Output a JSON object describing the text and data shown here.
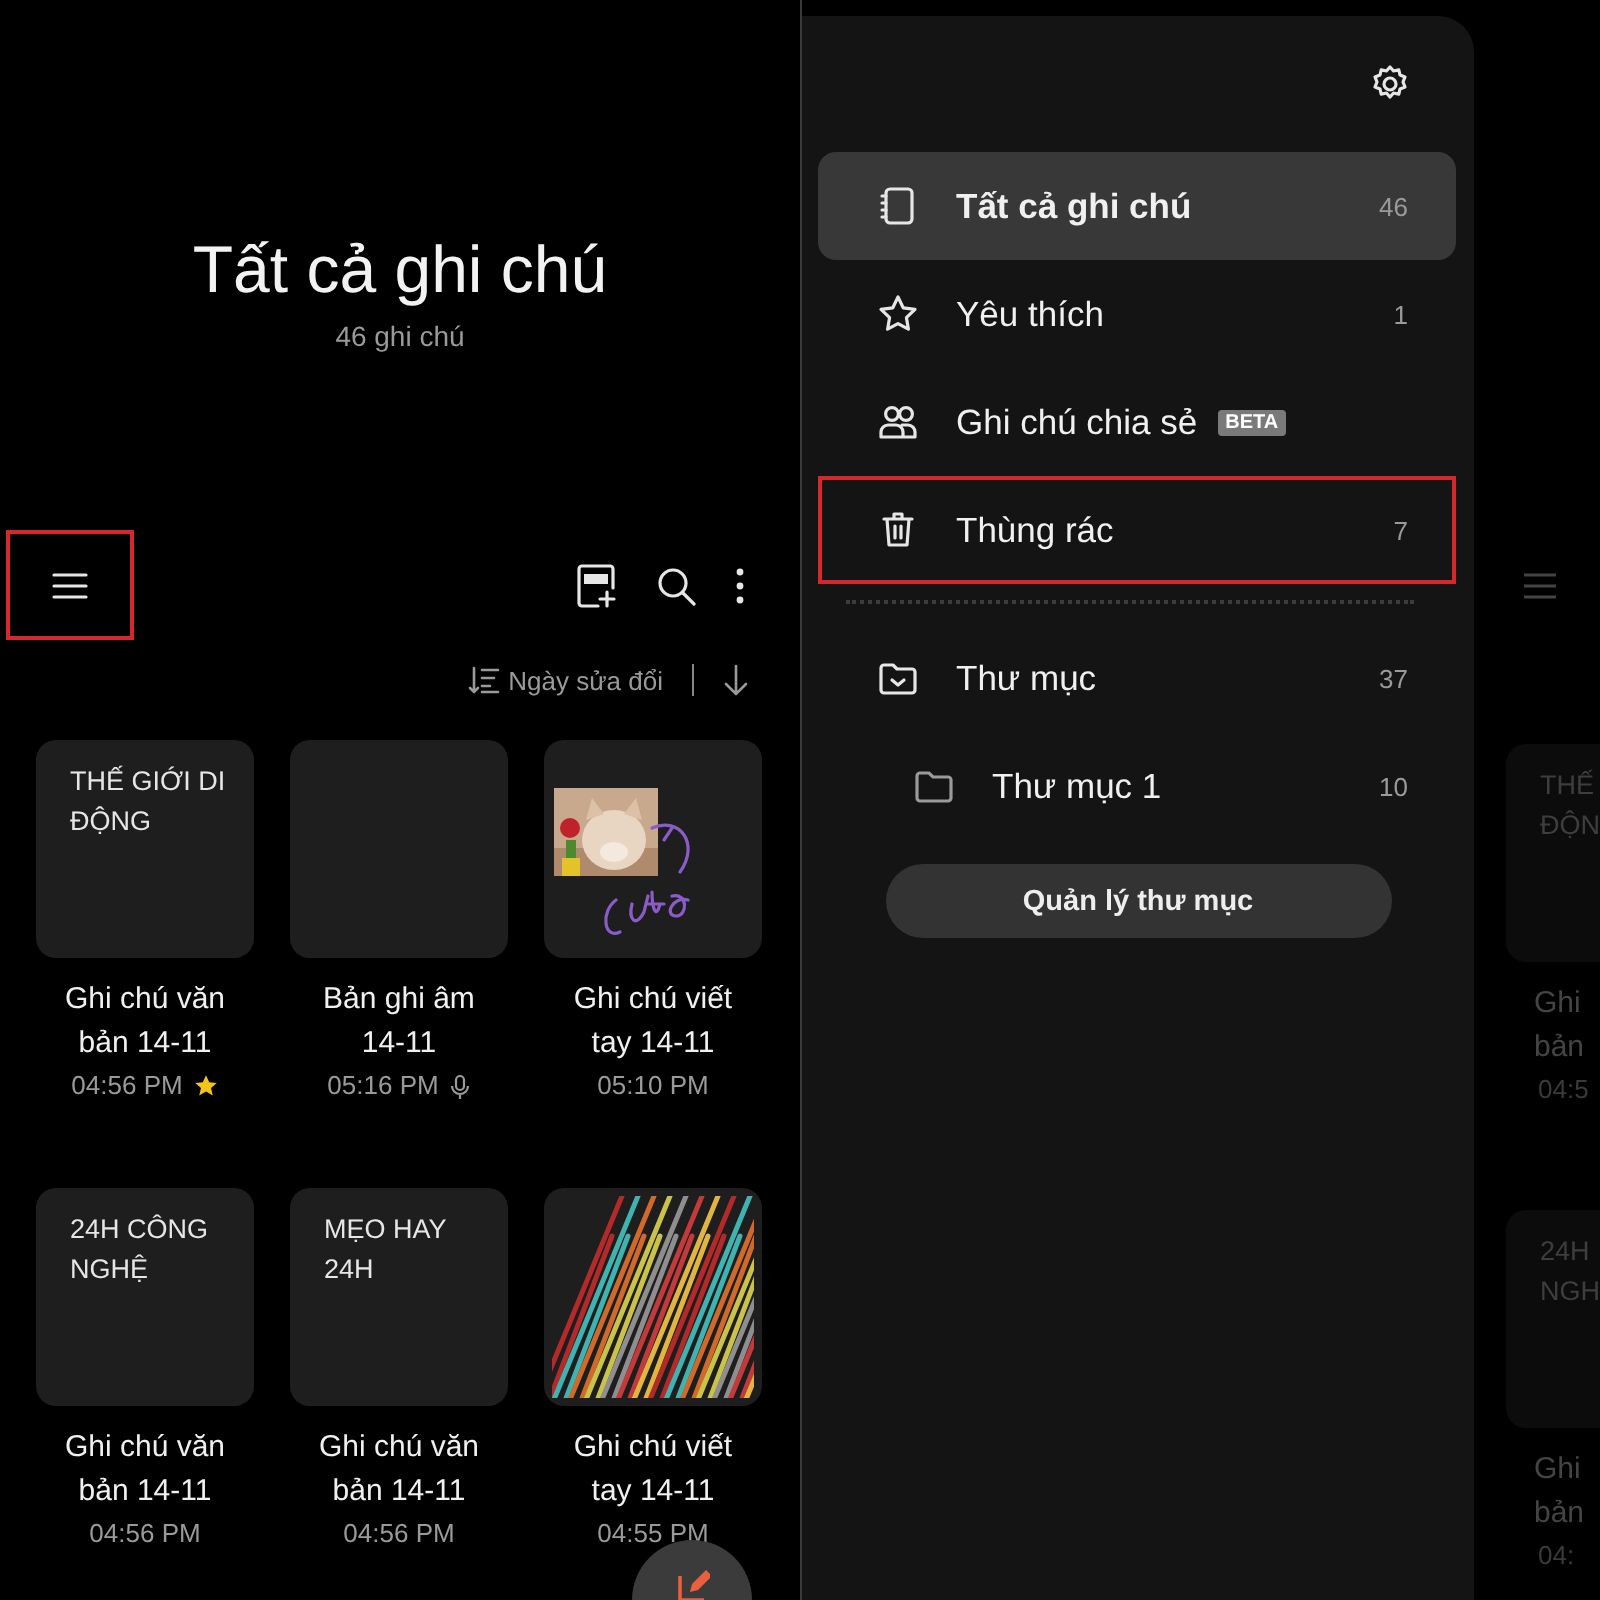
{
  "notes_screen": {
    "title": "Tất cả ghi chú",
    "subtitle": "46 ghi chú",
    "menu_button": {
      "highlighted": true
    },
    "sort": {
      "label": "Ngày sửa đổi"
    },
    "notes": [
      {
        "kind": "text",
        "preview": [
          "THẾ GIỚI DI",
          "ĐỘNG"
        ],
        "title": [
          "Ghi chú văn",
          "bản 14-11"
        ],
        "time": "04:56 PM",
        "favorite": true
      },
      {
        "kind": "audio",
        "title": [
          "Bản ghi âm",
          "14-11"
        ],
        "time": "05:16 PM",
        "favorite": false
      },
      {
        "kind": "handwriting_photo",
        "title": [
          "Ghi chú viết",
          "tay 14-11"
        ],
        "time": "05:10 PM",
        "favorite": false
      },
      {
        "kind": "text",
        "preview": [
          "24H CÔNG",
          "NGHỆ"
        ],
        "title": [
          "Ghi chú văn",
          "bản 14-11"
        ],
        "time": "04:56 PM",
        "favorite": false
      },
      {
        "kind": "text",
        "preview": [
          "MẸO HAY",
          "24H"
        ],
        "title": [
          "Ghi chú văn",
          "bản 14-11"
        ],
        "time": "04:56 PM",
        "favorite": false
      },
      {
        "kind": "scribble",
        "title": [
          "Ghi chú viết",
          "tay 14-11"
        ],
        "time": "04:55 PM",
        "favorite": false
      }
    ]
  },
  "drawer": {
    "items": [
      {
        "kind": "all",
        "label": "Tất cả ghi chú",
        "count": "46",
        "selected": true,
        "highlighted": false
      },
      {
        "kind": "favorites",
        "label": "Yêu thích",
        "count": "1",
        "selected": false,
        "highlighted": false
      },
      {
        "kind": "shared",
        "label": "Ghi chú chia sẻ",
        "badge": "BETA",
        "selected": false,
        "highlighted": false
      },
      {
        "kind": "trash",
        "label": "Thùng rác",
        "count": "7",
        "selected": false,
        "highlighted": true
      }
    ],
    "folders": [
      {
        "label": "Thư mục",
        "count": "37",
        "children": [
          {
            "label": "Thư mục 1",
            "count": "10"
          }
        ]
      }
    ],
    "manage_button": "Quản lý thư mục"
  },
  "background_peek": {
    "notes": [
      {
        "preview": [
          "THẾ",
          "ĐỘN"
        ],
        "title": [
          "Ghi",
          "bản"
        ],
        "time": "04:5"
      },
      {
        "preview": [
          "24H",
          "NGH"
        ],
        "title": [
          "Ghi",
          "bản"
        ],
        "time": "04:"
      }
    ]
  }
}
